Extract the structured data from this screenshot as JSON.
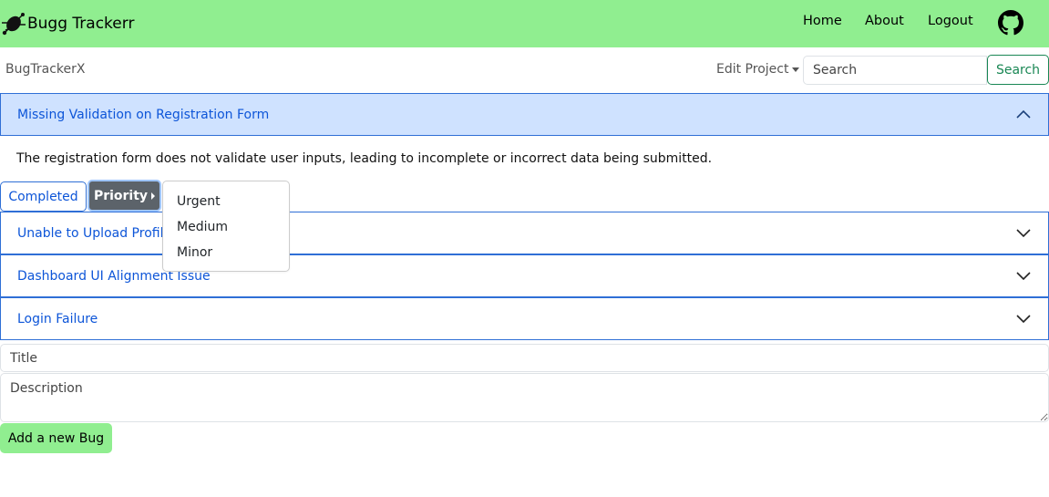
{
  "navbar": {
    "brand": "Bugg Trackerr",
    "links": [
      "Home",
      "About",
      "Logout"
    ],
    "github_icon": "github-icon",
    "background": "#90ee90"
  },
  "subbar": {
    "project_name": "BugTrackerX",
    "edit_project_label": "Edit Project",
    "search_placeholder": "Search",
    "search_button": "Search"
  },
  "bugs": [
    {
      "title": "Missing Validation on Registration Form",
      "expanded": true,
      "description": "The registration form does not validate user inputs, leading to incomplete or incorrect data being submitted."
    },
    {
      "title": "Unable to Upload Profile",
      "expanded": false
    },
    {
      "title": "Dashboard UI Alignment Issue",
      "expanded": false
    },
    {
      "title": "Login Failure",
      "expanded": false
    }
  ],
  "status_button": "Completed",
  "priority_button": "Priority",
  "priority_options": [
    "Urgent",
    "Medium",
    "Minor"
  ],
  "form": {
    "title_placeholder": "Title",
    "description_placeholder": "Description",
    "add_button": "Add a new Bug"
  },
  "colors": {
    "accent": "#0d55d8",
    "active_header": "#cfe2ff",
    "success": "#198754",
    "priority_bg": "#5c636a"
  }
}
